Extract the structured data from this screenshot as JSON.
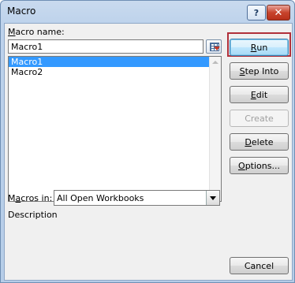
{
  "window": {
    "title": "Macro",
    "help_label": "?",
    "close_label": "✕"
  },
  "macro_name": {
    "label_pre": "",
    "label_u": "M",
    "label_post": "acro name:",
    "value": "Macro1"
  },
  "macros": [
    {
      "name": "Macro1",
      "selected": true
    },
    {
      "name": "Macro2",
      "selected": false
    }
  ],
  "macros_in": {
    "label_pre": "M",
    "label_u": "a",
    "label_post": "cros in:",
    "value": "All Open Workbooks"
  },
  "description_label": "Description",
  "buttons": {
    "run": {
      "pre": "",
      "u": "R",
      "post": "un"
    },
    "step": {
      "pre": "",
      "u": "S",
      "post": "tep Into"
    },
    "edit": {
      "pre": "",
      "u": "E",
      "post": "dit"
    },
    "create": {
      "pre": "",
      "u": "",
      "post": "Create"
    },
    "delete": {
      "pre": "",
      "u": "D",
      "post": "elete"
    },
    "options": {
      "pre": "",
      "u": "O",
      "post": "ptions..."
    },
    "cancel": {
      "pre": "",
      "u": "",
      "post": "Cancel"
    }
  }
}
